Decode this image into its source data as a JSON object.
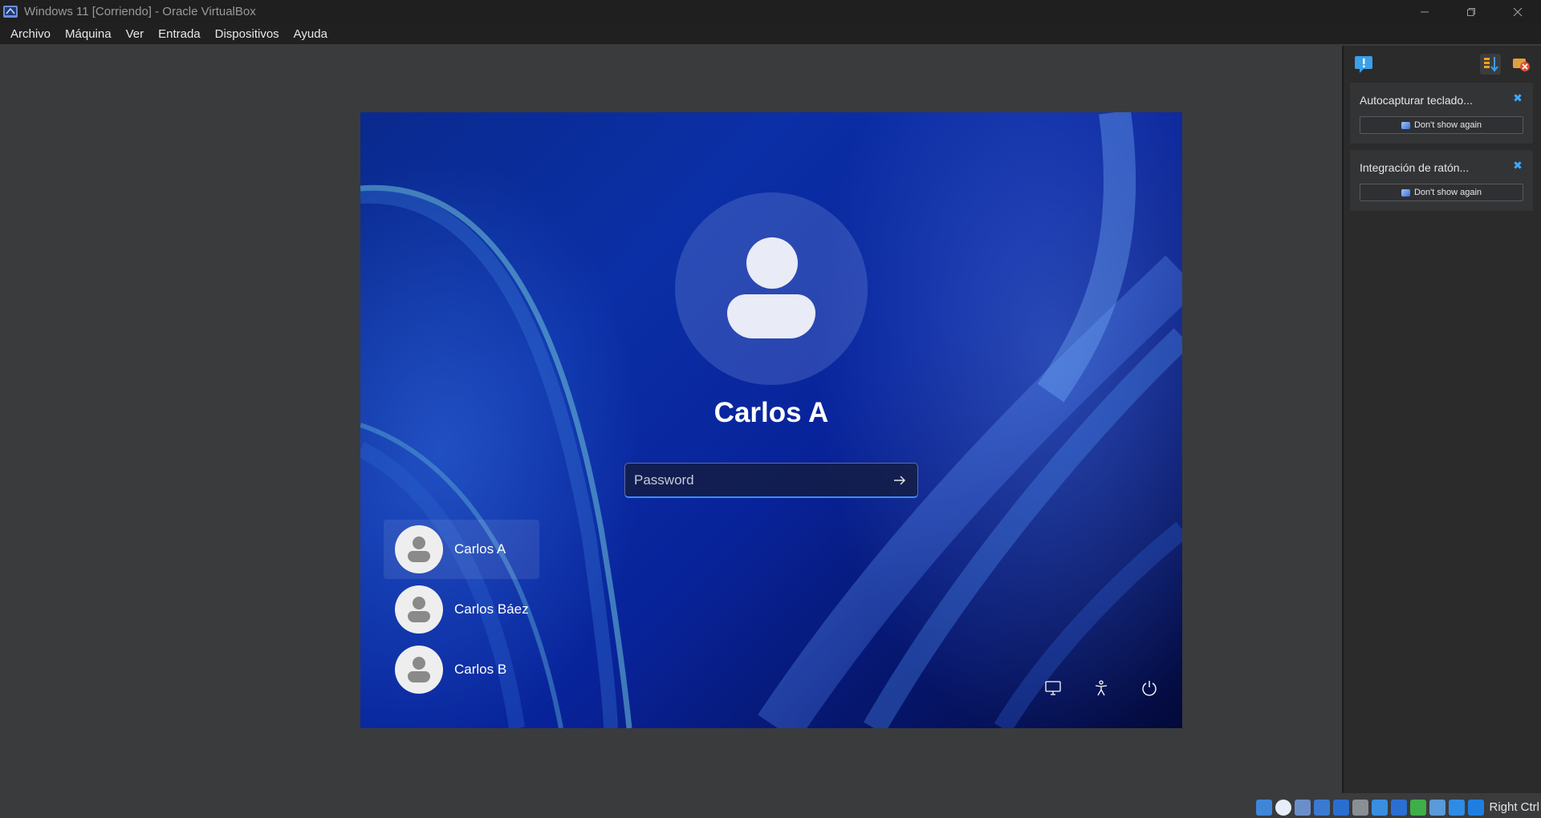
{
  "window": {
    "title": "Windows 11 [Corriendo] - Oracle VirtualBox",
    "controls": [
      "minimize",
      "restore",
      "close"
    ]
  },
  "menubar": {
    "items": [
      "Archivo",
      "Máquina",
      "Ver",
      "Entrada",
      "Dispositivos",
      "Ayuda"
    ]
  },
  "login": {
    "current_user": "Carlos A",
    "password_placeholder": "Password",
    "users": [
      "Carlos A",
      "Carlos Báez",
      "Carlos B"
    ],
    "selected_user_index": 0,
    "bottom_icons": [
      "display-icon",
      "accessibility-icon",
      "power-icon"
    ]
  },
  "notifications": {
    "items": [
      {
        "title": "Autocapturar teclado...",
        "button": "Don't show again"
      },
      {
        "title": "Integración de ratón...",
        "button": "Don't show again"
      }
    ]
  },
  "statusbar": {
    "host_key": "Right Ctrl",
    "icons": [
      "hard-disk-icon",
      "optical-drive-icon",
      "audio-icon",
      "network-icon",
      "usb-icon",
      "shared-folders-icon",
      "display-icon",
      "video-capture-icon",
      "mouse-integration-icon",
      "cpu-icon",
      "keyboard-icon",
      "download-icon"
    ]
  },
  "colors": {
    "titlebar": "#1f1f1f",
    "background": "#3a3b3d",
    "accent": "#3a8cff",
    "wallpaper": "#0b2fa6"
  }
}
